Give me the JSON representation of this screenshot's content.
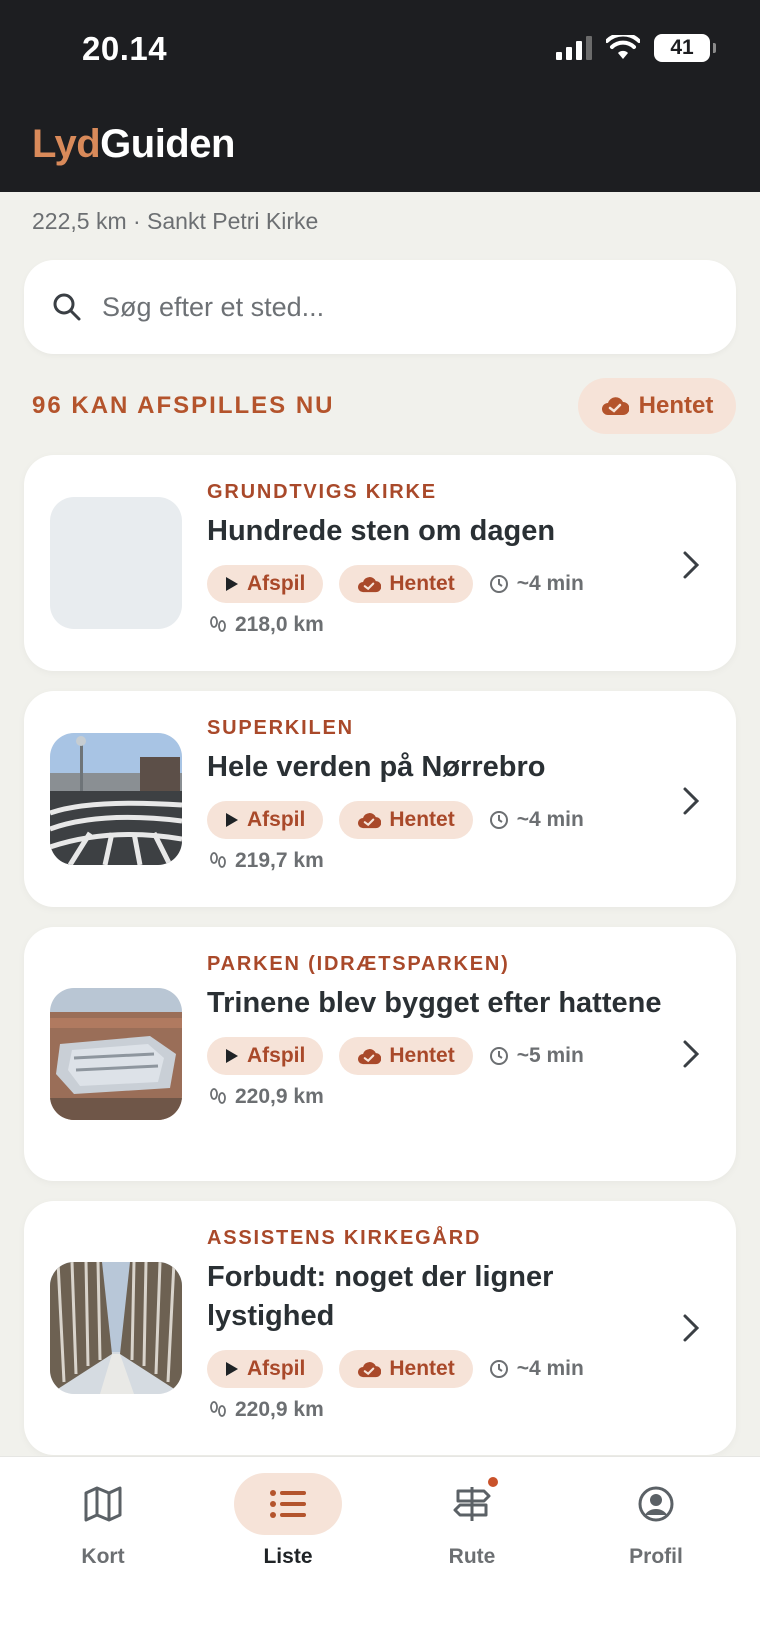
{
  "status_bar": {
    "time": "20.14",
    "battery": "41"
  },
  "app": {
    "title_part1": "Lyd",
    "title_part2": "Guiden"
  },
  "location": "222,5 km · Sankt Petri Kirke",
  "search": {
    "placeholder": "Søg efter et sted..."
  },
  "list_header": {
    "count_label": "96 KAN AFSPILLES NU",
    "filter_label": "Hentet"
  },
  "colors": {
    "accent": "#b4542c",
    "header_bg": "#1d1e21",
    "chip_bg": "#f6e3d8"
  },
  "items": [
    {
      "place": "GRUNDTVIGS KIRKE",
      "title": "Hundrede sten om dagen",
      "play": "Afspil",
      "downloaded": "Hentet",
      "duration": "~4 min",
      "distance": "218,0 km",
      "thumb": "blank"
    },
    {
      "place": "SUPERKILEN",
      "title": "Hele verden på Nørrebro",
      "play": "Afspil",
      "downloaded": "Hentet",
      "duration": "~4 min",
      "distance": "219,7 km",
      "thumb": "superkilen"
    },
    {
      "place": "PARKEN (IDRÆTSPARKEN)",
      "title": "Trinene blev bygget efter hattene",
      "play": "Afspil",
      "downloaded": "Hentet",
      "duration": "~5 min",
      "distance": "220,9 km",
      "thumb": "stadium"
    },
    {
      "place": "ASSISTENS KIRKEGÅRD",
      "title": "Forbudt: noget der ligner lystighed",
      "play": "Afspil",
      "downloaded": "Hentet",
      "duration": "~4 min",
      "distance": "220,9 km",
      "thumb": "avenue"
    }
  ],
  "tabs": [
    {
      "label": "Kort",
      "icon": "map-icon"
    },
    {
      "label": "Liste",
      "icon": "list-icon",
      "active": true
    },
    {
      "label": "Rute",
      "icon": "signpost-icon",
      "badge": true
    },
    {
      "label": "Profil",
      "icon": "profile-icon"
    }
  ]
}
